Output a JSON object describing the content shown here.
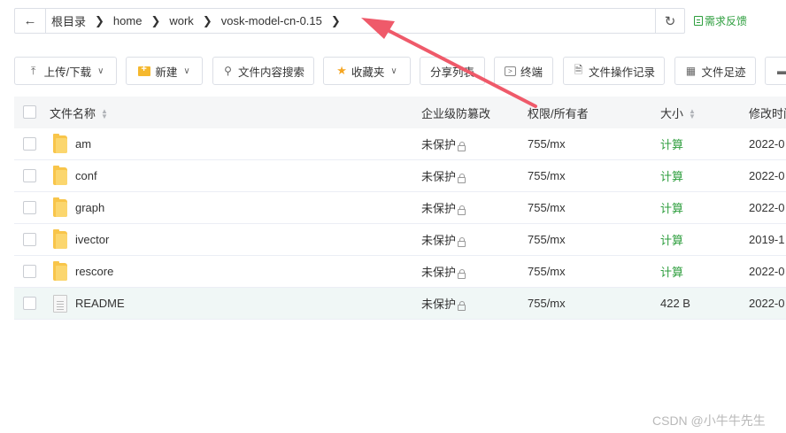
{
  "breadcrumb": {
    "items": [
      "根目录",
      "home",
      "work",
      "vosk-model-cn-0.15"
    ]
  },
  "feedback_label": "需求反馈",
  "toolbar": {
    "upload": "上传/下载",
    "new": "新建",
    "search": "文件内容搜索",
    "favorites": "收藏夹",
    "share": "分享列表",
    "terminal": "终端",
    "oplog": "文件操作记录",
    "footprint": "文件足迹"
  },
  "table": {
    "headers": {
      "name": "文件名称",
      "protect": "企业级防篡改",
      "perm": "权限/所有者",
      "size": "大小",
      "mtime": "修改时间"
    },
    "rows": [
      {
        "name": "am",
        "type": "folder",
        "protect": "未保护",
        "perm": "755/mx",
        "size": "计算",
        "mtime": "2022-0"
      },
      {
        "name": "conf",
        "type": "folder",
        "protect": "未保护",
        "perm": "755/mx",
        "size": "计算",
        "mtime": "2022-0"
      },
      {
        "name": "graph",
        "type": "folder",
        "protect": "未保护",
        "perm": "755/mx",
        "size": "计算",
        "mtime": "2022-0"
      },
      {
        "name": "ivector",
        "type": "folder",
        "protect": "未保护",
        "perm": "755/mx",
        "size": "计算",
        "mtime": "2019-1"
      },
      {
        "name": "rescore",
        "type": "folder",
        "protect": "未保护",
        "perm": "755/mx",
        "size": "计算",
        "mtime": "2022-0"
      },
      {
        "name": "README",
        "type": "file",
        "protect": "未保护",
        "perm": "755/mx",
        "size": "422 B",
        "mtime": "2022-0"
      }
    ]
  },
  "annotation_color": "#ef5a6a",
  "watermark": "CSDN @小牛牛先生"
}
